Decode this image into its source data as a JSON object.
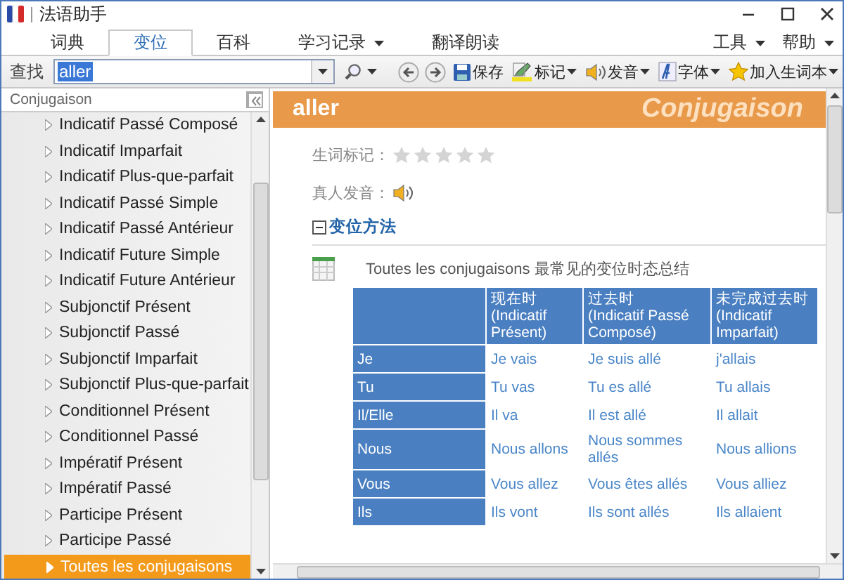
{
  "window": {
    "title": "法语助手"
  },
  "menu_tabs": [
    {
      "label": "词典",
      "selected": false,
      "dropdown": false
    },
    {
      "label": "变位",
      "selected": true,
      "dropdown": false
    },
    {
      "label": "百科",
      "selected": false,
      "dropdown": false
    },
    {
      "label": "学习记录",
      "selected": false,
      "dropdown": true
    },
    {
      "label": "翻译朗读",
      "selected": false,
      "dropdown": false
    }
  ],
  "menu_right": [
    {
      "label": "工具",
      "dropdown": true
    },
    {
      "label": "帮助",
      "dropdown": true
    }
  ],
  "toolbar": {
    "search_label": "查找",
    "search_value": "aller",
    "buttons": [
      {
        "kind": "save",
        "label": "保存",
        "dropdown": false
      },
      {
        "kind": "mark",
        "label": "标记",
        "dropdown": true
      },
      {
        "kind": "speak",
        "label": "发音",
        "dropdown": true
      },
      {
        "kind": "font",
        "label": "字体",
        "dropdown": true
      },
      {
        "kind": "add",
        "label": "加入生词本",
        "dropdown": true
      }
    ]
  },
  "sidebar": {
    "title": "Conjugaison",
    "items": [
      {
        "label": "Indicatif Passé Composé",
        "selected": false
      },
      {
        "label": "Indicatif Imparfait",
        "selected": false
      },
      {
        "label": "Indicatif Plus-que-parfait",
        "selected": false
      },
      {
        "label": "Indicatif Passé Simple",
        "selected": false
      },
      {
        "label": "Indicatif Passé Antérieur",
        "selected": false
      },
      {
        "label": "Indicatif Future Simple",
        "selected": false
      },
      {
        "label": "Indicatif Future Antérieur",
        "selected": false
      },
      {
        "label": "Subjonctif Présent",
        "selected": false
      },
      {
        "label": "Subjonctif Passé",
        "selected": false
      },
      {
        "label": "Subjonctif Imparfait",
        "selected": false
      },
      {
        "label": "Subjonctif Plus-que-parfait",
        "selected": false
      },
      {
        "label": "Conditionnel Présent",
        "selected": false
      },
      {
        "label": "Conditionnel Passé",
        "selected": false
      },
      {
        "label": "Impératif Présent",
        "selected": false
      },
      {
        "label": "Impératif Passé",
        "selected": false
      },
      {
        "label": "Participe Présent",
        "selected": false
      },
      {
        "label": "Participe Passé",
        "selected": false
      },
      {
        "label": "Toutes les conjugaisons",
        "selected": true
      }
    ]
  },
  "entry": {
    "word": "aller",
    "header_label": "Conjugaison",
    "mark_label": "生词标记：",
    "stars": 0,
    "pronunciation_label": "真人发音：",
    "section_title": "变位方法",
    "section_expanded": true,
    "table_caption": "Toutes les conjugaisons 最常见的变位时态总结",
    "table": {
      "columns": [
        {
          "cn": "现在时",
          "fr": "(Indicatif Présent)"
        },
        {
          "cn": "过去时",
          "fr": "(Indicatif Passé Composé)"
        },
        {
          "cn": "未完成过去时",
          "fr": "(Indicatif Imparfait)"
        }
      ],
      "rows": [
        {
          "person": "Je",
          "cells": [
            "Je vais",
            "Je suis allé",
            "j'allais"
          ]
        },
        {
          "person": "Tu",
          "cells": [
            "Tu vas",
            "Tu es allé",
            "Tu allais"
          ]
        },
        {
          "person": "Il/Elle",
          "cells": [
            "Il va",
            "Il est allé",
            "Il allait"
          ]
        },
        {
          "person": "Nous",
          "cells": [
            "Nous allons",
            "Nous sommes allés",
            "Nous allions"
          ]
        },
        {
          "person": "Vous",
          "cells": [
            "Vous allez",
            "Vous êtes allés",
            "Vous alliez"
          ]
        },
        {
          "person": "Ils",
          "cells": [
            "Ils vont",
            "Ils sont allés",
            "Ils allaient"
          ]
        }
      ]
    }
  }
}
